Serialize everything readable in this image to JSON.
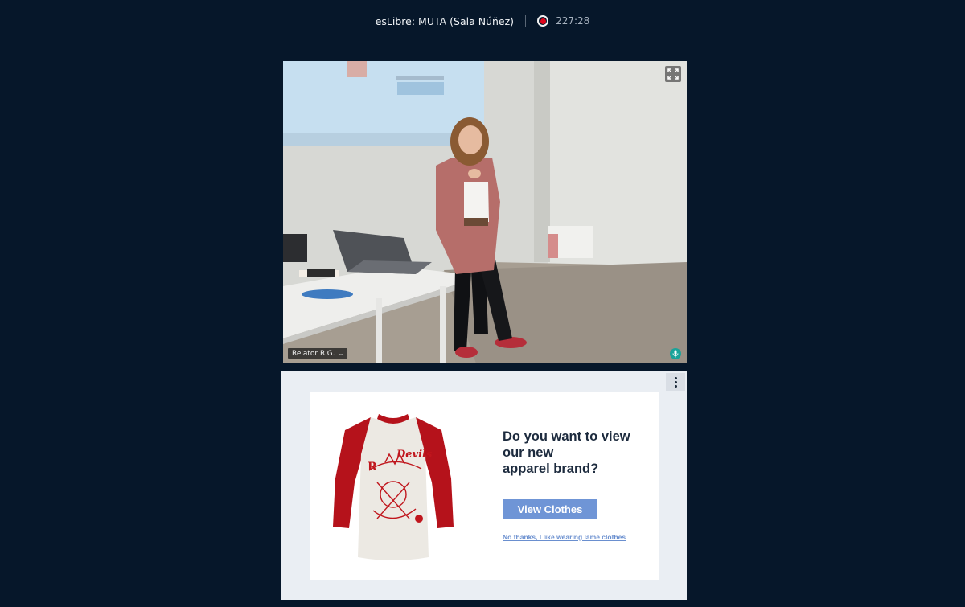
{
  "header": {
    "title": "esLibre: MUTA (Sala Núñez)",
    "timer": "227:28"
  },
  "video": {
    "participant_name": "Relator R.G."
  },
  "ad": {
    "heading": "Do you want to view\nour new\napparel brand?",
    "view_button": "View Clothes",
    "decline_link": "No thanks, I like wearing lame clothes"
  },
  "colors": {
    "background": "#06172a",
    "record": "#e0061b",
    "mic": "#1aa39a",
    "accent_button": "#6f95d6"
  },
  "icons": [
    "record-icon",
    "fullscreen-icon",
    "chevron-down-icon",
    "microphone-icon",
    "more-options-icon"
  ]
}
